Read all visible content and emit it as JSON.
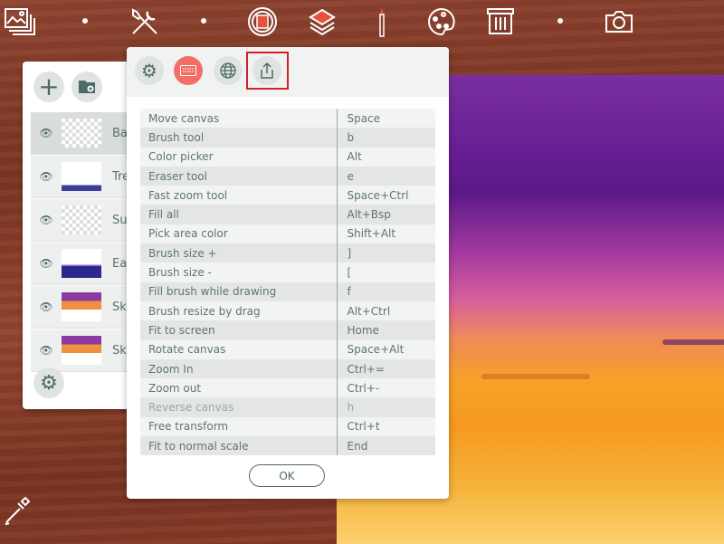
{
  "toolbar": {
    "icons": [
      "gallery-icon",
      "tools-icon",
      "frame-icon",
      "layers-icon",
      "brush-icon",
      "palette-icon",
      "brush-library-icon",
      "camera-icon"
    ]
  },
  "layers": {
    "items": [
      {
        "name": "Ba",
        "selected": true
      },
      {
        "name": "Tre"
      },
      {
        "name": "Su"
      },
      {
        "name": "Ea"
      },
      {
        "name": "Sk"
      },
      {
        "name": "Sk"
      }
    ]
  },
  "dialog": {
    "tabs": [
      "settings",
      "keyboard-shortcuts",
      "language",
      "export"
    ],
    "active_tab": "keyboard-shortcuts",
    "shortcuts": [
      {
        "action": "Move canvas",
        "key": "Space"
      },
      {
        "action": "Brush tool",
        "key": "b"
      },
      {
        "action": "Color picker",
        "key": "Alt"
      },
      {
        "action": "Eraser tool",
        "key": "e"
      },
      {
        "action": "Fast zoom tool",
        "key": "Space+Ctrl"
      },
      {
        "action": "Fill all",
        "key": "Alt+Bsp"
      },
      {
        "action": "Pick area color",
        "key": "Shift+Alt"
      },
      {
        "action": "Brush size +",
        "key": "]"
      },
      {
        "action": "Brush size -",
        "key": "["
      },
      {
        "action": "Fill brush while drawing",
        "key": "f"
      },
      {
        "action": "Brush resize by drag",
        "key": "Alt+Ctrl"
      },
      {
        "action": "Fit to screen",
        "key": "Home"
      },
      {
        "action": "Rotate canvas",
        "key": "Space+Alt"
      },
      {
        "action": "Zoom In",
        "key": "Ctrl+="
      },
      {
        "action": "Zoom out",
        "key": "Ctrl+-"
      },
      {
        "action": "Reverse canvas",
        "key": "h",
        "disabled": true
      },
      {
        "action": "Free transform",
        "key": "Ctrl+t"
      },
      {
        "action": "Fit to normal scale",
        "key": "End"
      }
    ],
    "ok_label": "OK"
  },
  "colors": {
    "accent": "#f26e66",
    "highlight": "#d51f26",
    "icon": "#4f6a66"
  }
}
